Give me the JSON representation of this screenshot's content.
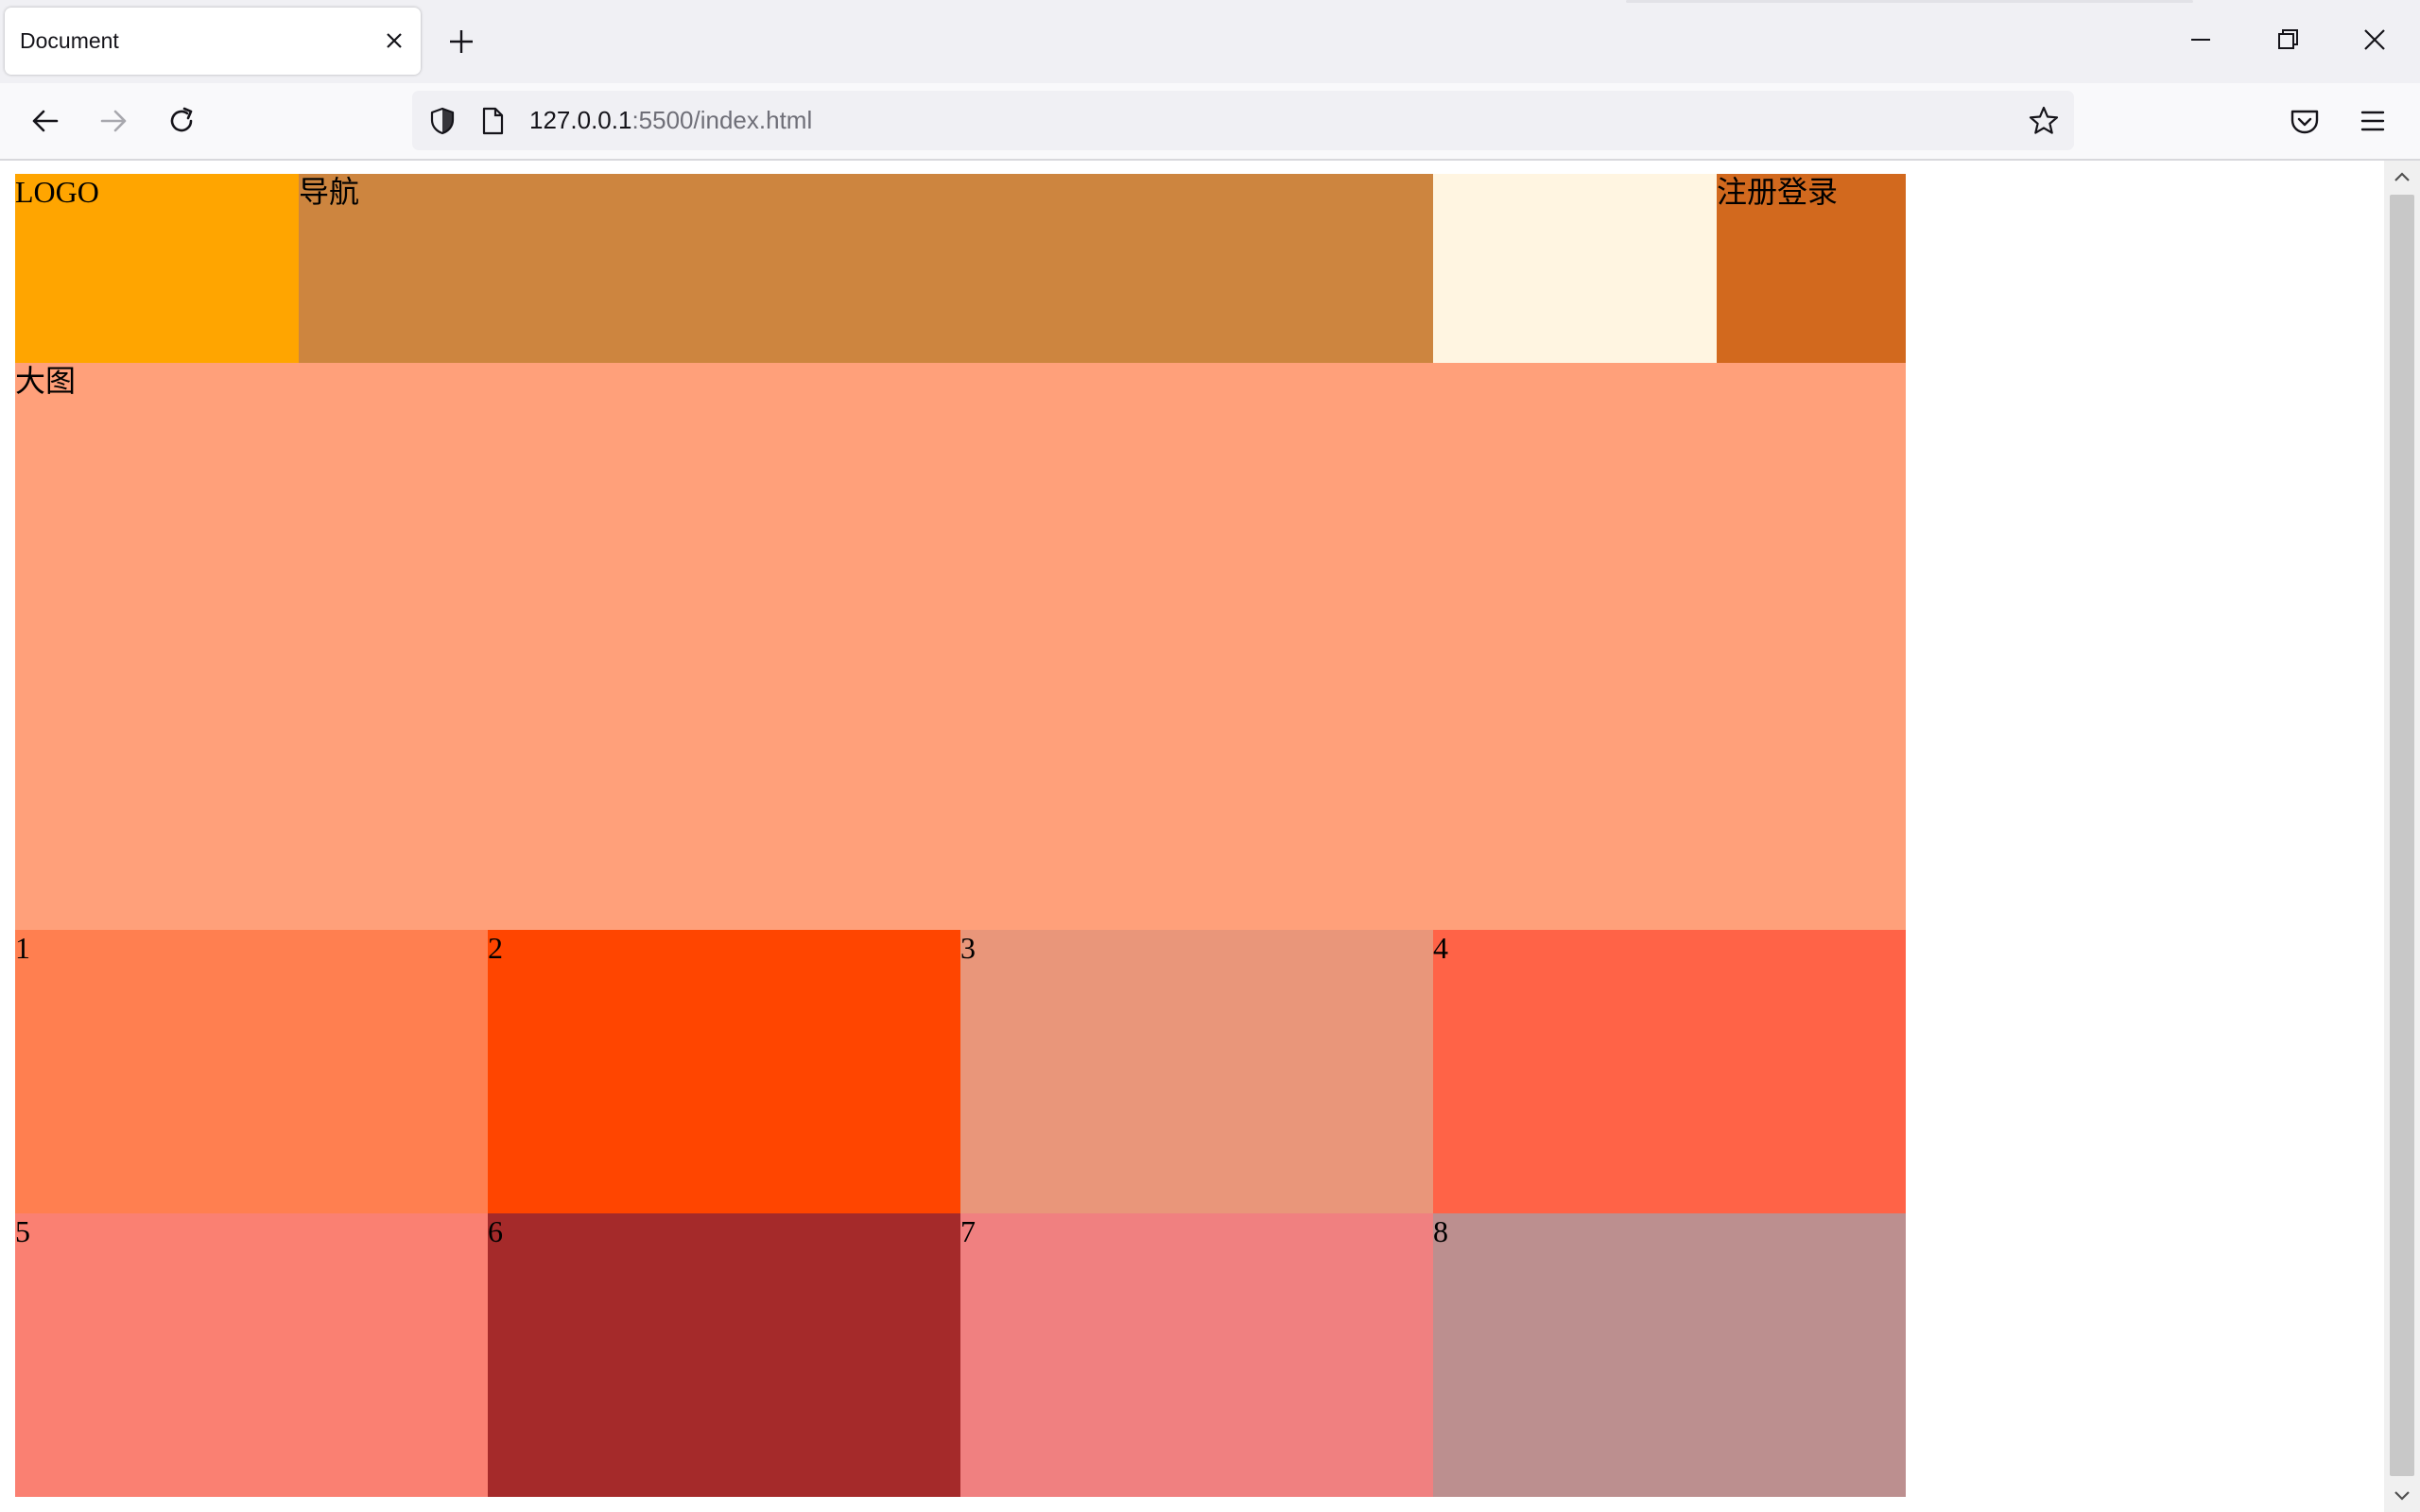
{
  "browser": {
    "tab_title": "Document",
    "url_host": "127.0.0.1",
    "url_rest": ":5500/index.html"
  },
  "page": {
    "header": {
      "logo": "LOGO",
      "nav": "导航",
      "auth": "注册登录"
    },
    "banner": "大图",
    "cells": [
      "1",
      "2",
      "3",
      "4",
      "5",
      "6",
      "7",
      "8"
    ]
  },
  "colors": {
    "logo": "#ffa500",
    "nav": "#cd853f",
    "blank": "#fff5e1",
    "auth": "#d2691e",
    "banner": "#ffa07a",
    "cells": [
      "#ff7f50",
      "#ff4500",
      "#e9967a",
      "#ff6347",
      "#fa8072",
      "#a52a2a",
      "#f08080",
      "#bc8f8f"
    ]
  },
  "icons": [
    "close-icon",
    "plus-icon",
    "minimize-icon",
    "restore-icon",
    "back-arrow-icon",
    "forward-arrow-icon",
    "reload-icon",
    "shield-icon",
    "page-icon",
    "star-icon",
    "pocket-icon",
    "menu-icon"
  ]
}
